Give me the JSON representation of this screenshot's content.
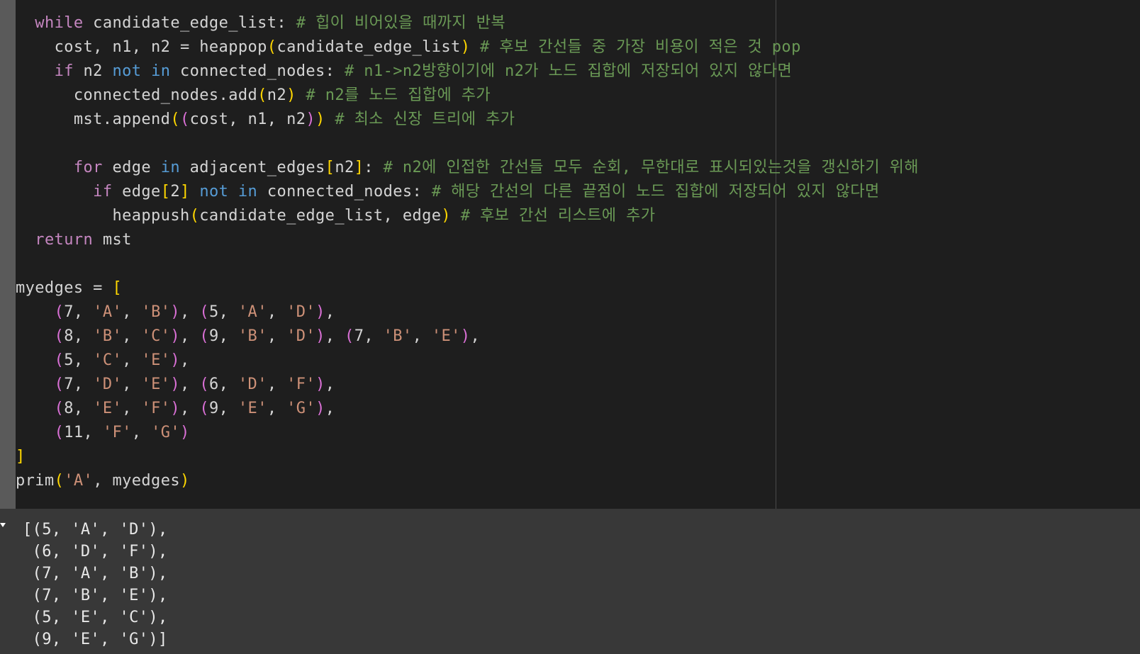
{
  "code": {
    "lines": [
      [
        {
          "t": "  "
        },
        {
          "t": "while",
          "c": "kw"
        },
        {
          "t": " candidate_edge_list: "
        },
        {
          "t": "# 힙이 비어있을 때까지 반복",
          "c": "cm"
        }
      ],
      [
        {
          "t": "    cost, n1, n2 = heappop"
        },
        {
          "t": "(",
          "c": "b1"
        },
        {
          "t": "candidate_edge_list"
        },
        {
          "t": ")",
          "c": "b1"
        },
        {
          "t": " "
        },
        {
          "t": "# 후보 간선들 중 가장 비용이 적은 것 pop",
          "c": "cm"
        }
      ],
      [
        {
          "t": "    "
        },
        {
          "t": "if",
          "c": "kw"
        },
        {
          "t": " n2 "
        },
        {
          "t": "not in",
          "c": "kw2"
        },
        {
          "t": " connected_nodes: "
        },
        {
          "t": "# n1->n2방향이기에 n2가 노드 집합에 저장되어 있지 않다면",
          "c": "cm"
        }
      ],
      [
        {
          "t": "      connected_nodes.add"
        },
        {
          "t": "(",
          "c": "b1"
        },
        {
          "t": "n2"
        },
        {
          "t": ")",
          "c": "b1"
        },
        {
          "t": " "
        },
        {
          "t": "# n2를 노드 집합에 추가",
          "c": "cm"
        }
      ],
      [
        {
          "t": "      mst.append"
        },
        {
          "t": "(",
          "c": "b1"
        },
        {
          "t": "(",
          "c": "b2"
        },
        {
          "t": "cost, n1, n2"
        },
        {
          "t": ")",
          "c": "b2"
        },
        {
          "t": ")",
          "c": "b1"
        },
        {
          "t": " "
        },
        {
          "t": "# 최소 신장 트리에 추가",
          "c": "cm"
        }
      ],
      [
        {
          "t": ""
        }
      ],
      [
        {
          "t": "      "
        },
        {
          "t": "for",
          "c": "kw"
        },
        {
          "t": " edge "
        },
        {
          "t": "in",
          "c": "kw2"
        },
        {
          "t": " adjacent_edges"
        },
        {
          "t": "[",
          "c": "b1"
        },
        {
          "t": "n2"
        },
        {
          "t": "]",
          "c": "b1"
        },
        {
          "t": ": "
        },
        {
          "t": "# n2에 인접한 간선들 모두 순회, 무한대로 표시되있는것을 갱신하기 위해",
          "c": "cm"
        }
      ],
      [
        {
          "t": "        "
        },
        {
          "t": "if",
          "c": "kw"
        },
        {
          "t": " edge"
        },
        {
          "t": "[",
          "c": "b1"
        },
        {
          "t": "2"
        },
        {
          "t": "]",
          "c": "b1"
        },
        {
          "t": " "
        },
        {
          "t": "not in",
          "c": "kw2"
        },
        {
          "t": " connected_nodes: "
        },
        {
          "t": "# 해당 간선의 다른 끝점이 노드 집합에 저장되어 있지 않다면",
          "c": "cm"
        }
      ],
      [
        {
          "t": "          heappush"
        },
        {
          "t": "(",
          "c": "b1"
        },
        {
          "t": "candidate_edge_list, edge"
        },
        {
          "t": ")",
          "c": "b1"
        },
        {
          "t": " "
        },
        {
          "t": "# 후보 간선 리스트에 추가",
          "c": "cm"
        }
      ],
      [
        {
          "t": "  "
        },
        {
          "t": "return",
          "c": "kw"
        },
        {
          "t": " mst"
        }
      ],
      [
        {
          "t": ""
        }
      ],
      [
        {
          "t": "myedges = "
        },
        {
          "t": "[",
          "c": "b1"
        }
      ],
      [
        {
          "t": "    "
        },
        {
          "t": "(",
          "c": "b2"
        },
        {
          "t": "7, "
        },
        {
          "t": "'A'",
          "c": "str"
        },
        {
          "t": ", "
        },
        {
          "t": "'B'",
          "c": "str"
        },
        {
          "t": ")",
          "c": "b2"
        },
        {
          "t": ", "
        },
        {
          "t": "(",
          "c": "b2"
        },
        {
          "t": "5, "
        },
        {
          "t": "'A'",
          "c": "str"
        },
        {
          "t": ", "
        },
        {
          "t": "'D'",
          "c": "str"
        },
        {
          "t": ")",
          "c": "b2"
        },
        {
          "t": ","
        }
      ],
      [
        {
          "t": "    "
        },
        {
          "t": "(",
          "c": "b2"
        },
        {
          "t": "8, "
        },
        {
          "t": "'B'",
          "c": "str"
        },
        {
          "t": ", "
        },
        {
          "t": "'C'",
          "c": "str"
        },
        {
          "t": ")",
          "c": "b2"
        },
        {
          "t": ", "
        },
        {
          "t": "(",
          "c": "b2"
        },
        {
          "t": "9, "
        },
        {
          "t": "'B'",
          "c": "str"
        },
        {
          "t": ", "
        },
        {
          "t": "'D'",
          "c": "str"
        },
        {
          "t": ")",
          "c": "b2"
        },
        {
          "t": ", "
        },
        {
          "t": "(",
          "c": "b2"
        },
        {
          "t": "7, "
        },
        {
          "t": "'B'",
          "c": "str"
        },
        {
          "t": ", "
        },
        {
          "t": "'E'",
          "c": "str"
        },
        {
          "t": ")",
          "c": "b2"
        },
        {
          "t": ","
        }
      ],
      [
        {
          "t": "    "
        },
        {
          "t": "(",
          "c": "b2"
        },
        {
          "t": "5, "
        },
        {
          "t": "'C'",
          "c": "str"
        },
        {
          "t": ", "
        },
        {
          "t": "'E'",
          "c": "str"
        },
        {
          "t": ")",
          "c": "b2"
        },
        {
          "t": ","
        }
      ],
      [
        {
          "t": "    "
        },
        {
          "t": "(",
          "c": "b2"
        },
        {
          "t": "7, "
        },
        {
          "t": "'D'",
          "c": "str"
        },
        {
          "t": ", "
        },
        {
          "t": "'E'",
          "c": "str"
        },
        {
          "t": ")",
          "c": "b2"
        },
        {
          "t": ", "
        },
        {
          "t": "(",
          "c": "b2"
        },
        {
          "t": "6, "
        },
        {
          "t": "'D'",
          "c": "str"
        },
        {
          "t": ", "
        },
        {
          "t": "'F'",
          "c": "str"
        },
        {
          "t": ")",
          "c": "b2"
        },
        {
          "t": ","
        }
      ],
      [
        {
          "t": "    "
        },
        {
          "t": "(",
          "c": "b2"
        },
        {
          "t": "8, "
        },
        {
          "t": "'E'",
          "c": "str"
        },
        {
          "t": ", "
        },
        {
          "t": "'F'",
          "c": "str"
        },
        {
          "t": ")",
          "c": "b2"
        },
        {
          "t": ", "
        },
        {
          "t": "(",
          "c": "b2"
        },
        {
          "t": "9, "
        },
        {
          "t": "'E'",
          "c": "str"
        },
        {
          "t": ", "
        },
        {
          "t": "'G'",
          "c": "str"
        },
        {
          "t": ")",
          "c": "b2"
        },
        {
          "t": ","
        }
      ],
      [
        {
          "t": "    "
        },
        {
          "t": "(",
          "c": "b2"
        },
        {
          "t": "11, "
        },
        {
          "t": "'F'",
          "c": "str"
        },
        {
          "t": ", "
        },
        {
          "t": "'G'",
          "c": "str"
        },
        {
          "t": ")",
          "c": "b2"
        }
      ],
      [
        {
          "t": "]",
          "c": "b1"
        }
      ],
      [
        {
          "t": "prim"
        },
        {
          "t": "(",
          "c": "b1"
        },
        {
          "t": "'A'",
          "c": "str"
        },
        {
          "t": ", myedges"
        },
        {
          "t": ")",
          "c": "b1"
        }
      ]
    ]
  },
  "output": {
    "lines": [
      "[(5, 'A', 'D'),",
      " (6, 'D', 'F'),",
      " (7, 'A', 'B'),",
      " (7, 'B', 'E'),",
      " (5, 'E', 'C'),",
      " (9, 'E', 'G')]"
    ]
  },
  "colors": {
    "background": "#1e1e1e",
    "output_background": "#383838",
    "keyword": "#c586c0",
    "operator_keyword": "#569cd6",
    "comment": "#6a9955",
    "string": "#ce9178",
    "bracket_level1": "#ffd700",
    "bracket_level2": "#da70d6"
  },
  "icons": {
    "output_toggle": "collapse-arrow-icon"
  }
}
